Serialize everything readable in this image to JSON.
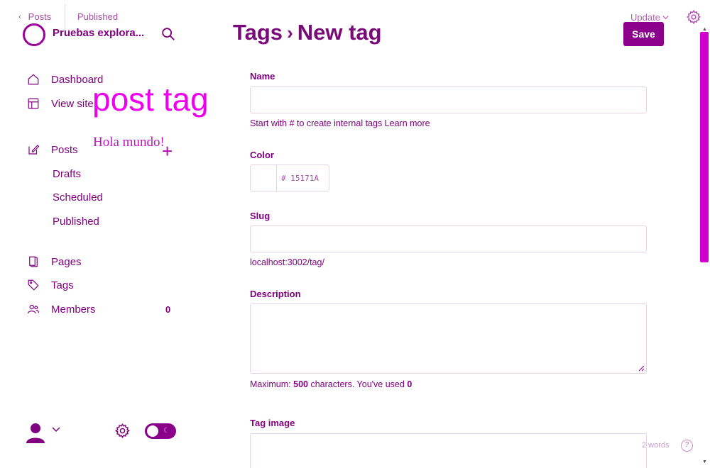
{
  "topbar": {
    "back_label": "Posts",
    "back_chevron": "‹",
    "published_label": "Published",
    "update_label": "Update",
    "update_chevron": "⌵"
  },
  "site": {
    "name": "Pruebas explora..."
  },
  "header": {
    "breadcrumb_parent": "Tags",
    "breadcrumb_sep": "›",
    "breadcrumb_current": "New tag",
    "save_label": "Save"
  },
  "sidebar": {
    "items": [
      {
        "label": "Dashboard",
        "icon": "home-icon"
      },
      {
        "label": "View site",
        "icon": "layout-icon"
      },
      {
        "label": "Posts",
        "icon": "edit-icon"
      },
      {
        "label": "Drafts"
      },
      {
        "label": "Scheduled"
      },
      {
        "label": "Published"
      },
      {
        "label": "Pages",
        "icon": "page-icon"
      },
      {
        "label": "Tags",
        "icon": "tag-icon"
      },
      {
        "label": "Members",
        "icon": "members-icon",
        "count": "0"
      }
    ],
    "plus": "+"
  },
  "overlay": {
    "post_tag": "post tag",
    "hola": "Hola mundo!"
  },
  "form": {
    "name_label": "Name",
    "name_value": "",
    "name_hint": "Start with # to create internal tags Learn more",
    "color_label": "Color",
    "color_hash": "#",
    "color_value": "15171A",
    "slug_label": "Slug",
    "slug_value": "",
    "slug_hint": "localhost:3002/tag/",
    "description_label": "Description",
    "description_value": "",
    "desc_hint_prefix": "Maximum:",
    "desc_max": "500",
    "desc_hint_mid": "characters. You've used",
    "desc_used": "0",
    "tag_image_label": "Tag image"
  },
  "footer": {
    "words": "2 words",
    "help": "?"
  },
  "colors": {
    "accent": "#800080",
    "save_bg": "#8b008b",
    "overlay_pink": "#ee00ee",
    "scrollbar": "#d000d0"
  }
}
